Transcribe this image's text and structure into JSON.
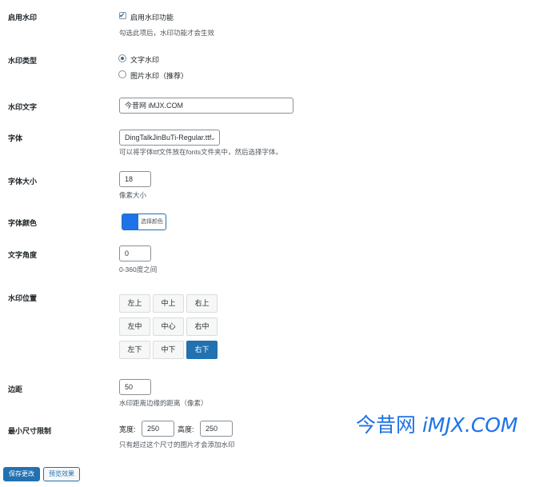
{
  "enable": {
    "label": "启用水印",
    "checkbox_label": "启用水印功能",
    "checked": true,
    "desc": "勾选此项后，水印功能才会生效"
  },
  "type": {
    "label": "水印类型",
    "options": [
      {
        "label": "文字水印",
        "selected": true
      },
      {
        "label": "图片水印（推荐）",
        "selected": false
      }
    ]
  },
  "text": {
    "label": "水印文字",
    "value": "今昔网 iMJX.COM"
  },
  "font": {
    "label": "字体",
    "selected": "DingTalkJinBuTi-Regular.ttf",
    "desc": "可以将字体ttf文件放在fonts文件夹中，然后选择字体。"
  },
  "size": {
    "label": "字体大小",
    "value": "18",
    "desc": "像素大小"
  },
  "color": {
    "label": "字体颜色",
    "button_label": "选择颜色",
    "value": "#1e73e8"
  },
  "angle": {
    "label": "文字角度",
    "value": "0",
    "desc": "0-360度之间"
  },
  "position": {
    "label": "水印位置",
    "cells": [
      "左上",
      "中上",
      "右上",
      "左中",
      "中心",
      "右中",
      "左下",
      "中下",
      "右下"
    ],
    "selected": "右下"
  },
  "margin": {
    "label": "边距",
    "value": "50",
    "desc": "水印距离边缘的距离（像素）"
  },
  "min_size": {
    "label": "最小尺寸限制",
    "width_label": "宽度:",
    "width_value": "250",
    "height_label": "高度:",
    "height_value": "250",
    "desc": "只有超过这个尺寸的图片才会添加水印"
  },
  "actions": {
    "save": "保存更改",
    "preview": "预览效果"
  },
  "watermark_preview": {
    "prefix": "今昔网 ",
    "brand": "iMJX.COM",
    "color": "#1e73e8"
  }
}
